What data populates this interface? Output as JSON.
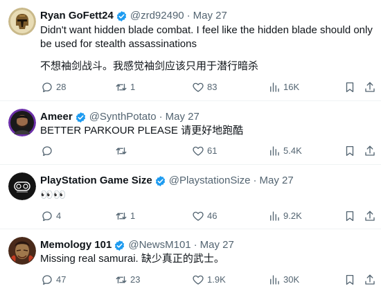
{
  "tweets": [
    {
      "name": "Ryan GoFett24",
      "handle": "@zrd92490",
      "separator": "·",
      "date": "May 27",
      "text_lines": [
        "Didn't want hidden blade combat. I feel like the hidden blade should only be used for stealth assassinations",
        "不想袖剑战斗。我感觉袖剑应该只用于潜行暗杀"
      ],
      "replies": "28",
      "retweets": "1",
      "likes": "83",
      "views": "16K",
      "avatar_icon": "mandalorian-helmet-avatar"
    },
    {
      "name": "Ameer",
      "handle": "@SynthPotato",
      "separator": "·",
      "date": "May 27",
      "text_lines": [
        "BETTER PARKOUR PLEASE 请更好地跑酷"
      ],
      "replies": "",
      "retweets": "",
      "likes": "61",
      "views": "5.4K",
      "avatar_icon": "person-photo-avatar"
    },
    {
      "name": "PlayStation Game Size",
      "handle": "@PlaystationSize",
      "separator": "·",
      "date": "May 27",
      "text_lines": [
        "👀👀"
      ],
      "replies": "4",
      "retweets": "1",
      "likes": "46",
      "views": "9.2K",
      "avatar_icon": "controller-logo-avatar"
    },
    {
      "name": "Memology 101",
      "handle": "@NewsM101",
      "separator": "·",
      "date": "May 27",
      "text_lines": [
        "Missing real samurai. 缺少真正的武士。"
      ],
      "replies": "47",
      "retweets": "23",
      "likes": "1.9K",
      "views": "30K",
      "avatar_icon": "warrior-portrait-avatar"
    }
  ],
  "colors": {
    "verified": "#1d9bf0",
    "secondary_text": "#536471",
    "primary_text": "#0f1419",
    "divider": "#eff3f4"
  }
}
